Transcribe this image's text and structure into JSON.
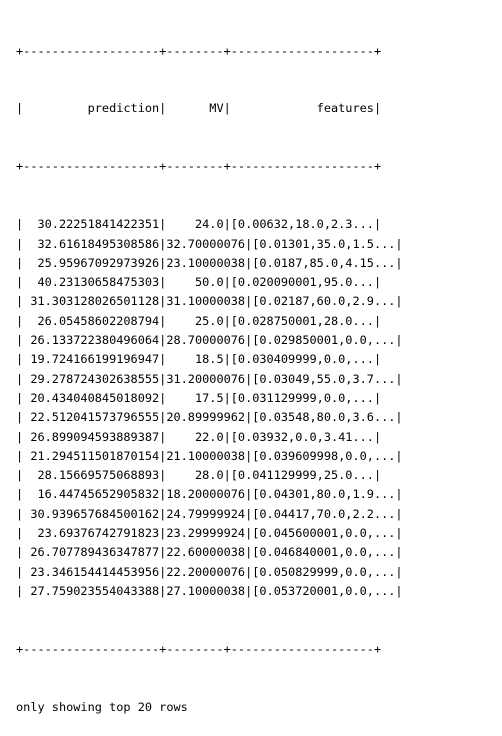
{
  "table": {
    "border": "+-------------------+--------+--------------------+",
    "header": "|         prediction|      MV|            features|",
    "columns": [
      "prediction",
      "MV",
      "features"
    ],
    "rows": [
      [
        "30.22251841422351",
        "24.0",
        "[0.00632,18.0,2.3..."
      ],
      [
        "32.61618495308586",
        "32.70000076",
        "[0.01301,35.0,1.5..."
      ],
      [
        "25.95967092973926",
        "23.10000038",
        "[0.0187,85.0,4.15..."
      ],
      [
        "40.23130658475303",
        "50.0",
        "[0.020090001,95.0..."
      ],
      [
        "31.303128026501128",
        "31.10000038",
        "[0.02187,60.0,2.9..."
      ],
      [
        "26.05458602208794",
        "25.0",
        "[0.028750001,28.0..."
      ],
      [
        "26.133722380496064",
        "28.70000076",
        "[0.029850001,0.0,..."
      ],
      [
        "19.724166199196947",
        "18.5",
        "[0.030409999,0.0,..."
      ],
      [
        "29.278724302638555",
        "31.20000076",
        "[0.03049,55.0,3.7..."
      ],
      [
        "20.434040845018092",
        "17.5",
        "[0.031129999,0.0,..."
      ],
      [
        "22.512041573796555",
        "20.89999962",
        "[0.03548,80.0,3.6..."
      ],
      [
        "26.899094593889387",
        "22.0",
        "[0.03932,0.0,3.41..."
      ],
      [
        "21.294511501870154",
        "21.10000038",
        "[0.039609998,0.0,..."
      ],
      [
        "28.15669575068893",
        "28.0",
        "[0.041129999,25.0..."
      ],
      [
        "16.44745652905832",
        "18.20000076",
        "[0.04301,80.0,1.9..."
      ],
      [
        "30.939657684500162",
        "24.79999924",
        "[0.04417,70.0,2.2..."
      ],
      [
        "23.69376742791823",
        "23.29999924",
        "[0.045600001,0.0,..."
      ],
      [
        "26.707789436347877",
        "22.60000038",
        "[0.046840001,0.0,..."
      ],
      [
        "23.346154414453956",
        "22.20000076",
        "[0.050829999,0.0,..."
      ],
      [
        "27.759023554043388",
        "27.10000038",
        "[0.053720001,0.0,..."
      ]
    ]
  },
  "footer": "only showing top 20 rows"
}
